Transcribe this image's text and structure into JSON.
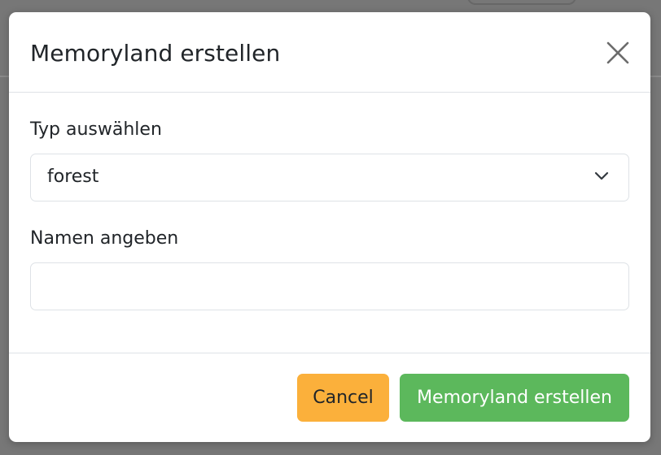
{
  "modal": {
    "title": "Memoryland erstellen"
  },
  "form": {
    "type_label": "Typ auswählen",
    "type_selected": "forest",
    "name_label": "Namen angeben",
    "name_value": "",
    "name_placeholder": ""
  },
  "footer": {
    "cancel_label": "Cancel",
    "submit_label": "Memoryland erstellen"
  },
  "icons": {
    "close": "close-icon",
    "dropdown": "chevron-down-icon"
  },
  "colors": {
    "cancel_button": "#fbb03b",
    "submit_button": "#5cb85c",
    "backdrop": "#777777"
  }
}
